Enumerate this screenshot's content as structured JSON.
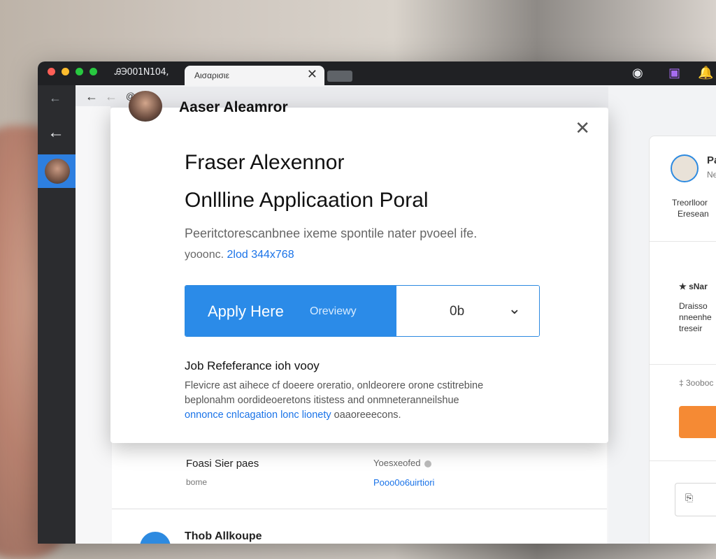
{
  "browser": {
    "tab_inactive": "ᎯЭ001Ν104,",
    "tab_active_title": "Aισαρισιε",
    "tab_close": "✕",
    "address_url": "@ɒır",
    "back_glyph": "←",
    "forward_glyph": "←",
    "top_icons": [
      "◉",
      "▣",
      "🔔"
    ]
  },
  "modal_header": "Aaser Aleamror",
  "modal": {
    "close": "✕",
    "title_line1": "Fraser Alexennor",
    "title_line2": "Onllline Applicaation Poral",
    "desc_line1": "Peeritctorescanbnee ixeme spontile nater pvoeel ife.",
    "desc_line2_prefix": "yooonc.",
    "desc_line2_link": "2lod 344x768",
    "apply_label": "Apply Here",
    "apply_sub": "Oreviewy",
    "select_value": "0b",
    "select_chevron": "⌄",
    "jobref_title": "Job Refeferance ioh vooy",
    "para_line1": "Flevicre ast aihece cf doeere oreratio, onldeorere orone cstitrebine",
    "para_line2": "beplonahm oordideoeretons itistess and onmneteranneilshue",
    "para_line3_link": "onnonce cnlcagation",
    "para_line3_link2": "lonc lionety",
    "para_line3_rest": "oaaoreeecons."
  },
  "back_card": {
    "label1": "Foasi Sier paes",
    "label2": "bome",
    "label3": "Yoesxeofed",
    "link": "Pooo0o6uirtiori"
  },
  "bottom_card": {
    "text": "Thob Allkoupe"
  },
  "right_panel": {
    "name_initial": "Pa",
    "name_sub": "Ne",
    "line1": "Treorlloor",
    "line2": "Eresean",
    "section_label": "★ sNar",
    "text1": "Draisso",
    "text2": "nneenhe",
    "text3": "treseir",
    "footer": "‡ 3ooboc",
    "box_icon": "⎘"
  }
}
